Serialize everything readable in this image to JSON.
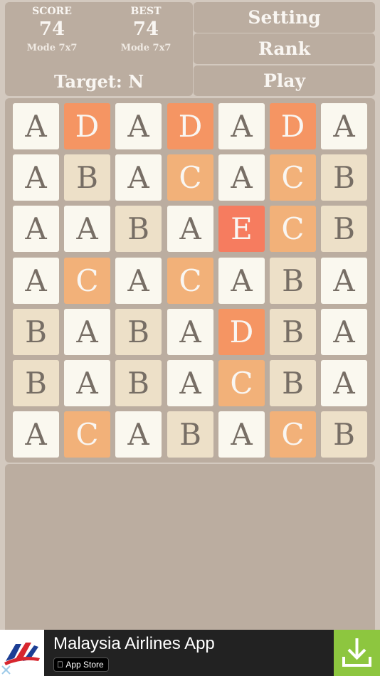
{
  "score": {
    "title": "SCORE",
    "value": "74",
    "mode": "Mode 7x7"
  },
  "best": {
    "title": "BEST",
    "value": "74",
    "mode": "Mode 7x7"
  },
  "target": "Target: N",
  "menu": {
    "setting": "Setting",
    "rank": "Rank",
    "play": "Play"
  },
  "board": {
    "rows": [
      [
        "A",
        "D",
        "A",
        "D",
        "A",
        "D",
        "A"
      ],
      [
        "A",
        "B",
        "A",
        "C",
        "A",
        "C",
        "B"
      ],
      [
        "A",
        "A",
        "B",
        "A",
        "E",
        "C",
        "B"
      ],
      [
        "A",
        "C",
        "A",
        "C",
        "A",
        "B",
        "A"
      ],
      [
        "B",
        "A",
        "B",
        "A",
        "D",
        "B",
        "A"
      ],
      [
        "B",
        "A",
        "B",
        "A",
        "C",
        "B",
        "A"
      ],
      [
        "A",
        "C",
        "A",
        "B",
        "A",
        "C",
        "B"
      ]
    ]
  },
  "tile_colors": {
    "A": {
      "bg": "#faf8ef",
      "fg": "#776e65"
    },
    "B": {
      "bg": "#ede0c8",
      "fg": "#776e65"
    },
    "C": {
      "bg": "#f2b179",
      "fg": "#f9f6f2"
    },
    "D": {
      "bg": "#f59563",
      "fg": "#f9f6f2"
    },
    "E": {
      "bg": "#f67c5f",
      "fg": "#f9f6f2"
    }
  },
  "ad": {
    "title": "Malaysia Airlines App",
    "store_label": "App Store",
    "download_color": "#8dc63f"
  }
}
